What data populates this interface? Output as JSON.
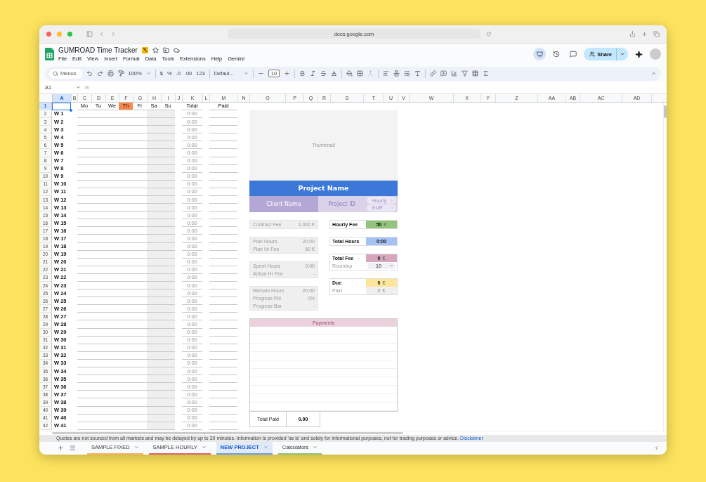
{
  "browser": {
    "url": "docs.google.com"
  },
  "document": {
    "title": "GUMROAD Time Tracker",
    "menus": [
      "File",
      "Edit",
      "View",
      "Insert",
      "Format",
      "Data",
      "Tools",
      "Extensions",
      "Help",
      "Gemini"
    ],
    "share": "Share"
  },
  "toolbar": {
    "search": "Menus",
    "zoom": "100%",
    "currency": "$",
    "percent": "%",
    "decrease_decimals": ".0",
    "increase_decimals": ".00",
    "number_format": "123",
    "font": "Defaul...",
    "font_size": "10"
  },
  "formula_bar": {
    "name_box": "A1",
    "label": "fx"
  },
  "columns": [
    {
      "label": "A",
      "selected": true
    },
    {
      "label": "B",
      "selected": false
    },
    {
      "label": "C",
      "selected": false
    },
    {
      "label": "D",
      "selected": false
    },
    {
      "label": "E",
      "selected": false
    },
    {
      "label": "F",
      "selected": false
    },
    {
      "label": "G",
      "selected": false
    },
    {
      "label": "H",
      "selected": false
    },
    {
      "label": "I",
      "selected": false
    },
    {
      "label": "J",
      "selected": false
    },
    {
      "label": "K",
      "selected": false
    },
    {
      "label": "L",
      "selected": false
    },
    {
      "label": "M",
      "selected": false
    },
    {
      "label": "N",
      "selected": false
    },
    {
      "label": "O",
      "selected": false
    },
    {
      "label": "P",
      "selected": false
    },
    {
      "label": "Q",
      "selected": false
    },
    {
      "label": "R",
      "selected": false
    },
    {
      "label": "S",
      "selected": false
    },
    {
      "label": "T",
      "selected": false
    },
    {
      "label": "U",
      "selected": false
    },
    {
      "label": "V",
      "selected": false
    },
    {
      "label": "W",
      "selected": false
    },
    {
      "label": "X",
      "selected": false
    },
    {
      "label": "Y",
      "selected": false
    },
    {
      "label": "Z",
      "selected": false
    },
    {
      "label": "AA",
      "selected": false
    },
    {
      "label": "AB",
      "selected": false
    },
    {
      "label": "AC",
      "selected": false
    },
    {
      "label": "AD",
      "selected": false
    }
  ],
  "header_row": {
    "number": "1",
    "days": [
      {
        "label": "Mo",
        "selected": false
      },
      {
        "label": "Tu",
        "selected": false
      },
      {
        "label": "We",
        "selected": false
      },
      {
        "label": "Th",
        "selected": true
      },
      {
        "label": "Fr",
        "selected": false
      },
      {
        "label": "Sa",
        "selected": false
      },
      {
        "label": "Su",
        "selected": false
      }
    ],
    "total": "Total",
    "paid": "Paid"
  },
  "week_rows": [
    {
      "number": "2",
      "week": "W 1",
      "total": "0:00"
    },
    {
      "number": "3",
      "week": "W 2",
      "total": "0:00"
    },
    {
      "number": "4",
      "week": "W 3",
      "total": "0:00"
    },
    {
      "number": "5",
      "week": "W 4",
      "total": "0:00"
    },
    {
      "number": "6",
      "week": "W 5",
      "total": "0:00"
    },
    {
      "number": "7",
      "week": "W 6",
      "total": "0:00"
    },
    {
      "number": "8",
      "week": "W 7",
      "total": "0:00"
    },
    {
      "number": "9",
      "week": "W 8",
      "total": "0:00"
    },
    {
      "number": "10",
      "week": "W 9",
      "total": "0:00"
    },
    {
      "number": "11",
      "week": "W 10",
      "total": "0:00"
    },
    {
      "number": "12",
      "week": "W 11",
      "total": "0:00"
    },
    {
      "number": "13",
      "week": "W 12",
      "total": "0:00"
    },
    {
      "number": "14",
      "week": "W 13",
      "total": "0:00"
    },
    {
      "number": "15",
      "week": "W 14",
      "total": "0:00"
    },
    {
      "number": "16",
      "week": "W 15",
      "total": "0:00"
    },
    {
      "number": "17",
      "week": "W 16",
      "total": "0:00"
    },
    {
      "number": "18",
      "week": "W 17",
      "total": "0:00"
    },
    {
      "number": "19",
      "week": "W 18",
      "total": "0:00"
    },
    {
      "number": "20",
      "week": "W 19",
      "total": "0:00"
    },
    {
      "number": "21",
      "week": "W 20",
      "total": "0:00"
    },
    {
      "number": "22",
      "week": "W 21",
      "total": "0:00"
    },
    {
      "number": "23",
      "week": "W 22",
      "total": "0:00"
    },
    {
      "number": "24",
      "week": "W 23",
      "total": "0:00"
    },
    {
      "number": "25",
      "week": "W 24",
      "total": "0:00"
    },
    {
      "number": "26",
      "week": "W 25",
      "total": "0:00"
    },
    {
      "number": "27",
      "week": "W 26",
      "total": "0:00"
    },
    {
      "number": "28",
      "week": "W 27",
      "total": "0:00"
    },
    {
      "number": "29",
      "week": "W 28",
      "total": "0:00"
    },
    {
      "number": "30",
      "week": "W 29",
      "total": "0:00"
    },
    {
      "number": "31",
      "week": "W 30",
      "total": "0:00"
    },
    {
      "number": "32",
      "week": "W 31",
      "total": "0:00"
    },
    {
      "number": "33",
      "week": "W 32",
      "total": "0:00"
    },
    {
      "number": "34",
      "week": "W 33",
      "total": "0:00"
    },
    {
      "number": "35",
      "week": "W 34",
      "total": "0:00"
    },
    {
      "number": "36",
      "week": "W 35",
      "total": "0:00"
    },
    {
      "number": "37",
      "week": "W 36",
      "total": "0:00"
    },
    {
      "number": "38",
      "week": "W 37",
      "total": "0:00"
    },
    {
      "number": "39",
      "week": "W 38",
      "total": "0:00"
    },
    {
      "number": "40",
      "week": "W 39",
      "total": "0:00"
    },
    {
      "number": "41",
      "week": "W 40",
      "total": "0:00"
    },
    {
      "number": "42",
      "week": "W 41",
      "total": "0:00"
    }
  ],
  "project": {
    "thumbnail": "Thumbnail",
    "name": "Project Name",
    "client": "Client Name",
    "project_id": "Project ID",
    "rate_type": "Hourly",
    "currency": "EUR",
    "summary_groups": [
      {
        "items": [
          {
            "label": "Contract Fee",
            "value": "1,000 €"
          }
        ]
      },
      {
        "items": [
          {
            "label": "Plan Hours",
            "value": "20:00"
          },
          {
            "label": "Plan Hr Fee",
            "value": "50 €"
          }
        ]
      },
      {
        "items": [
          {
            "label": "Spent Hours",
            "value": "0:00"
          },
          {
            "label": "Actual Hr Fee",
            "value": "-"
          }
        ]
      },
      {
        "items": [
          {
            "label": "Remain Hours",
            "value": "20:00"
          },
          {
            "label": "Progress Pct",
            "value": "0%"
          },
          {
            "label": "Progress Bar",
            "value": "-"
          }
        ]
      }
    ],
    "stat_groups": [
      {
        "items": [
          {
            "kind": "main",
            "label": "Hourly Fee",
            "value": "50",
            "unit": "€",
            "color": "#93c47d"
          }
        ]
      },
      {
        "items": [
          {
            "kind": "main",
            "label": "Total Hours",
            "value": "0:00",
            "color": "#a4c2f4"
          }
        ]
      },
      {
        "items": [
          {
            "kind": "main",
            "label": "Total Fee",
            "value": "0",
            "unit": "€",
            "color": "#d5a6bd"
          },
          {
            "kind": "dropdown",
            "label": "Roundup",
            "value": "10"
          }
        ]
      },
      {
        "items": [
          {
            "kind": "main",
            "label": "Due",
            "value": "0",
            "unit": "€",
            "color": "#ffe599"
          },
          {
            "kind": "sub",
            "label": "Paid",
            "value": "0",
            "unit": "€",
            "color": "#efefef"
          }
        ]
      }
    ]
  },
  "payments": {
    "title": "Payments",
    "total_label": "Total Paid",
    "total": "0.00"
  },
  "notice": {
    "text": "Quotes are not sourced from all markets and may be delayed by up to 20 minutes. Information is provided 'as is' and solely for informational purposes, not for trading purposes or advice.",
    "link": "Disclaimer"
  },
  "sheet_tabs": [
    {
      "label": "SAMPLE FIXED",
      "selected": false,
      "color": "#f6b26b"
    },
    {
      "label": "SAMPLE HOURLY",
      "selected": false,
      "color": "#e06666"
    },
    {
      "label": "NEW PROJECT",
      "selected": true,
      "color": "#6d9eeb"
    },
    {
      "label": "Calculators",
      "selected": false,
      "color": "#93c47d"
    }
  ]
}
